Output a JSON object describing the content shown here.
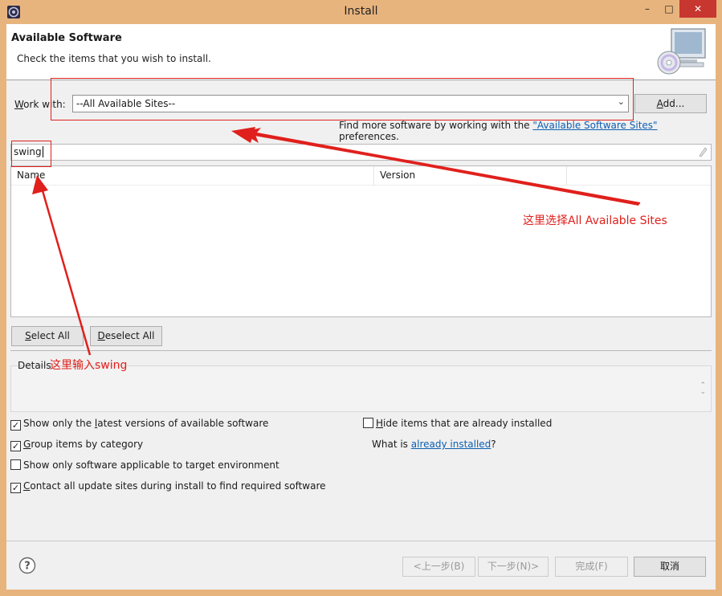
{
  "window": {
    "title": "Install",
    "min_glyph": "–",
    "max_glyph": "□",
    "close_glyph": "✕"
  },
  "header": {
    "title": "Available Software",
    "subtitle": "Check the items that you wish to install."
  },
  "work_with": {
    "label_prefix": "W",
    "label_rest": "ork with:",
    "value": "--All Available Sites--",
    "add_prefix": "A",
    "add_rest": "dd..."
  },
  "find_more": {
    "prefix": "Find more software by working with the ",
    "link": "\"Available Software Sites\"",
    "suffix": " preferences."
  },
  "filter": {
    "value": "swing"
  },
  "tree": {
    "columns": [
      "Name",
      "Version"
    ]
  },
  "buttons": {
    "select_all_prefix": "S",
    "select_all_rest": "elect All",
    "deselect_all_prefix": "D",
    "deselect_all_rest": "eselect All",
    "back": "<上一步(B)",
    "next": "下一步(N)>",
    "finish": "完成(F)",
    "cancel": "取消"
  },
  "details": {
    "label": "Details"
  },
  "options": {
    "latest": {
      "before": "Show only the ",
      "key": "l",
      "after": "atest versions of available software",
      "checked": true
    },
    "group": {
      "before": "",
      "key": "G",
      "after": "roup items by category",
      "checked": true
    },
    "applicable": {
      "before": "Show only software applicable to target environment",
      "key": "",
      "after": "",
      "checked": false
    },
    "contact": {
      "before": "",
      "key": "C",
      "after": "ontact all update sites during install to find required software",
      "checked": true
    },
    "hide": {
      "before": "",
      "key": "H",
      "after": "ide items that are already installed",
      "checked": false
    }
  },
  "what_is": {
    "prefix": "What is ",
    "link": "already installed",
    "suffix": "?"
  },
  "annotations": {
    "sites_note": "这里选择All Available Sites",
    "swing_note": "这里输入swing"
  },
  "colors": {
    "annotation": "#e0201c",
    "link": "#0c5fb3",
    "frame": "#e8b47e",
    "close": "#c7362f"
  }
}
